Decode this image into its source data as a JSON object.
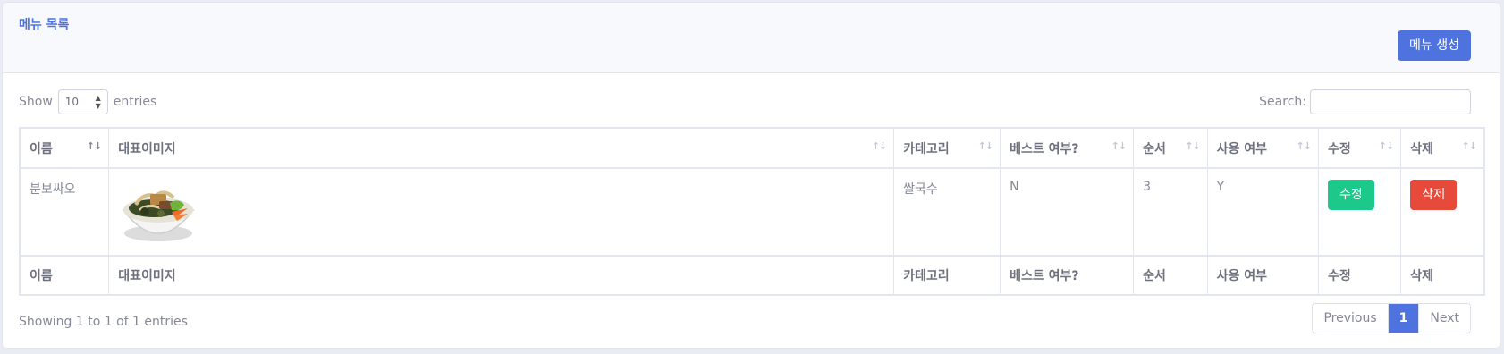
{
  "header": {
    "title": "메뉴 목록",
    "create_button": "메뉴 생성"
  },
  "length": {
    "show_label": "Show",
    "value": "10",
    "entries_label": "entries"
  },
  "search": {
    "label": "Search:",
    "value": ""
  },
  "table": {
    "columns": [
      "이름",
      "대표이미지",
      "카테고리",
      "베스트 여부?",
      "순서",
      "사용 여부",
      "수정",
      "삭제"
    ],
    "rows": [
      {
        "name": "분보싸오",
        "image": "bun-bo-xao-bowl",
        "category": "쌀국수",
        "best": "N",
        "order": "3",
        "use": "Y",
        "edit_label": "수정",
        "delete_label": "삭제"
      }
    ]
  },
  "info": "Showing 1 to 1 of 1 entries",
  "pagination": {
    "previous": "Previous",
    "current": "1",
    "next": "Next"
  },
  "colors": {
    "primary": "#4e73df",
    "success": "#1cc88a",
    "danger": "#e74a3b"
  }
}
